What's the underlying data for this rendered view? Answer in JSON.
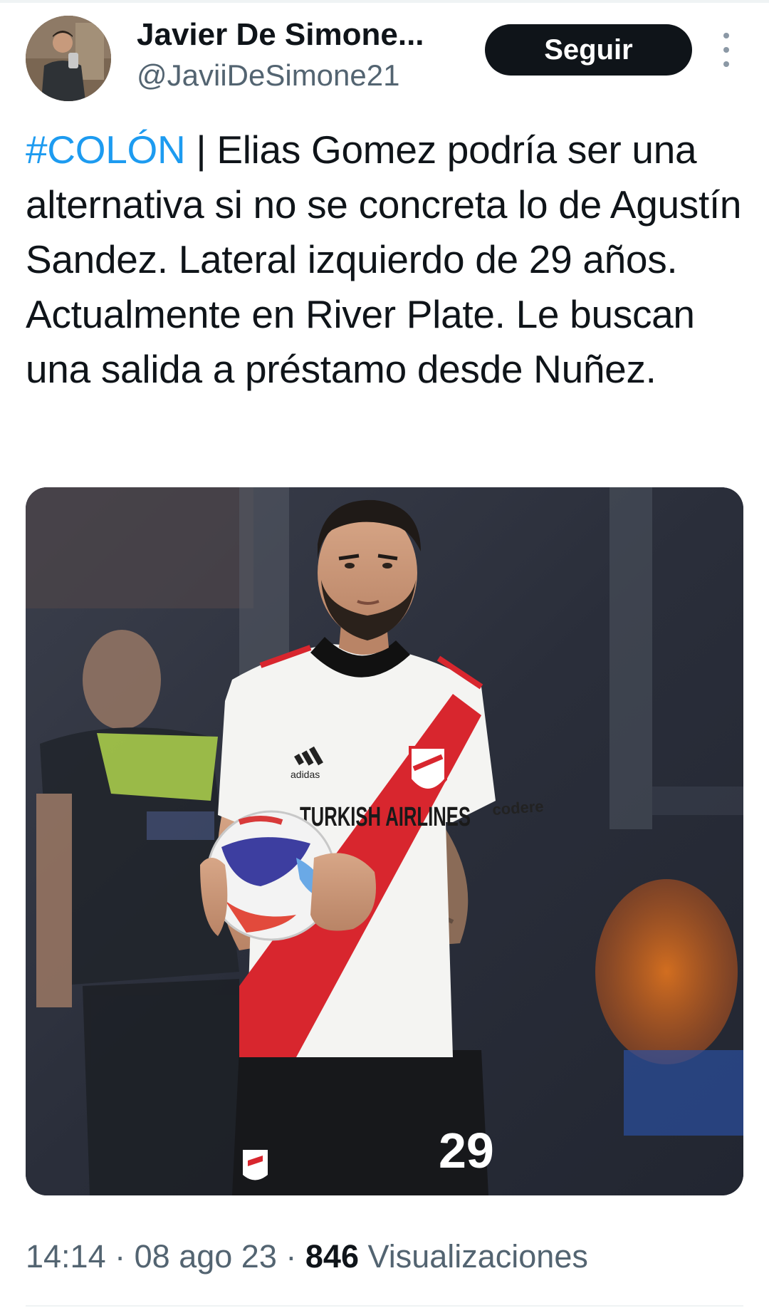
{
  "author": {
    "display_name": "Javier De Simone...",
    "handle": "@JaviiDeSimone21"
  },
  "follow_button": {
    "label": "Seguir"
  },
  "more_button": {
    "icon": "more-vertical-icon"
  },
  "tweet": {
    "hashtag": "#COLÓN",
    "body": " | Elias Gomez podría ser una alternativa si no se concreta lo de Agustín Sandez. Lateral izquierdo de 29 años. Actualmente en River Plate. Le buscan una salida a préstamo desde Nuñez."
  },
  "media": {
    "shirt_sponsor": "TURKISH AIRLINES",
    "shirt_brand": "adidas",
    "sleeve_sponsor": "codere",
    "shirt_number": "29"
  },
  "meta": {
    "time": "14:14",
    "separator": "·",
    "date": "08 ago 23",
    "views_count": "846",
    "views_label": "Visualizaciones"
  },
  "colors": {
    "link": "#1d9bf0",
    "button_bg": "#0f1419",
    "secondary_text": "#536471",
    "river_red": "#d8262e"
  }
}
